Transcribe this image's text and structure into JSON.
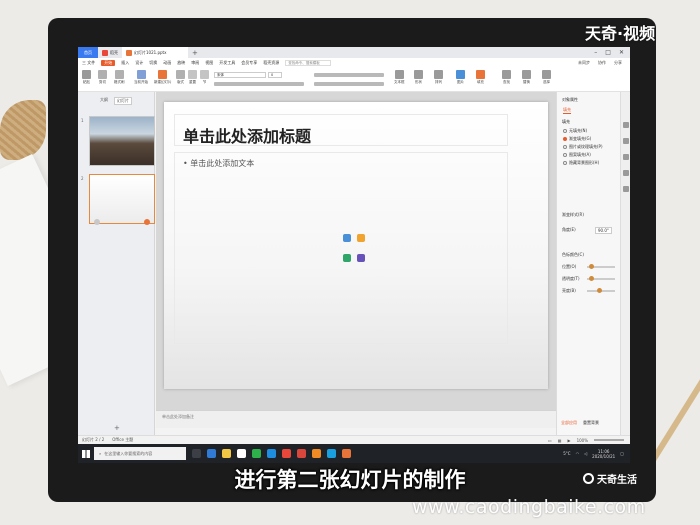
{
  "overlay": {
    "watermark_top": "天奇·视频",
    "subtitle": "进行第二张幻灯片的制作",
    "brand": "天奇生活",
    "site_url": "www.caodingbaike.com"
  },
  "app": {
    "tabs": {
      "home": "首页",
      "wps": "稻壳",
      "document": "幻灯片1021.pptx"
    },
    "menu": {
      "file": "三 文件",
      "items": [
        "开始",
        "插入",
        "设计",
        "切换",
        "动画",
        "放映",
        "审阅",
        "视图",
        "开发工具",
        "会员专享",
        "稻壳资源"
      ],
      "active": "开始",
      "search_placeholder": "查找命令、搜索模板",
      "right": [
        "未同步",
        "协作",
        "分享"
      ]
    },
    "ribbon": {
      "labels": [
        "粘贴",
        "剪切",
        "格式刷",
        "当前开始",
        "新建幻灯片",
        "版式",
        "重置",
        "节",
        "文本框",
        "形状",
        "排列",
        "图片",
        "填充",
        "查找",
        "替换",
        "选择"
      ],
      "font_name": "宋体",
      "font_size": "0"
    },
    "left_panel": {
      "tabs": [
        "大纲",
        "幻灯片"
      ],
      "active_tab": "幻灯片",
      "slide_numbers": [
        "1",
        "2"
      ],
      "add_icon": "plus-icon"
    },
    "slide": {
      "title_placeholder": "单击此处添加标题",
      "body_placeholder": "• 单击此处添加文本",
      "notes_placeholder": "单击此处添加备注"
    },
    "right_panel": {
      "title": "对象属性",
      "tab": "填充",
      "section": "填充",
      "fill_options": [
        "无填充(N)",
        "渐变填充(G)",
        "图片或纹理填充(P)",
        "图案填充(A)",
        "隐藏背景图形(H)"
      ],
      "selected_fill": "渐变填充(G)",
      "labels": [
        "渐变样式(R)",
        "角度(E)",
        "色标颜色(C)",
        "位置(O)",
        "透明度(T)",
        "亮度(B)"
      ],
      "angle_value": "90.0°",
      "footer": [
        "全部应用",
        "重置背景"
      ]
    },
    "statusbar": {
      "slide_info": "幻灯片 2 / 2",
      "theme": "Office 主题",
      "zoom": "100%"
    },
    "taskbar": {
      "search_placeholder": "在这里输入你要搜索的内容",
      "weather": "5°C",
      "time": "11:06",
      "date": "2020/10/21"
    }
  },
  "colors": {
    "accent": "#e85b2a",
    "taskbar": "#1f2227",
    "home_tab": "#3a7af0"
  }
}
